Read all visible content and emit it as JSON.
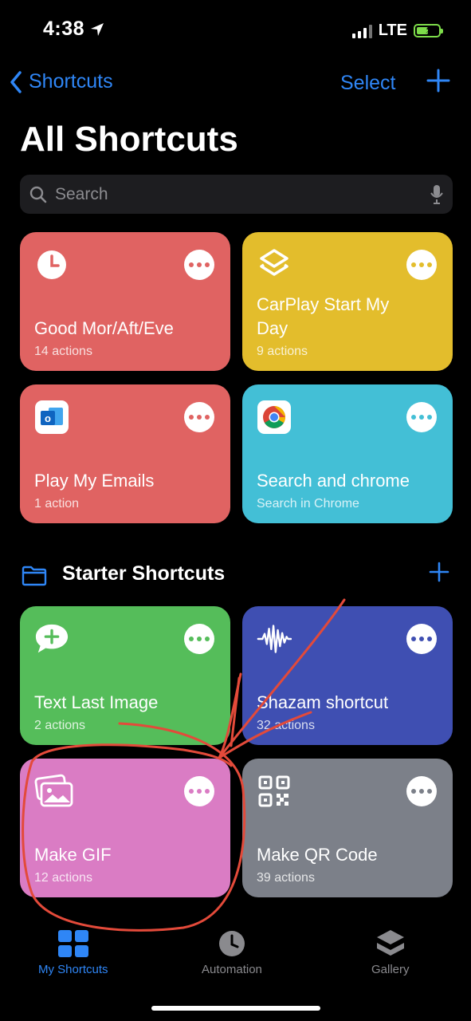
{
  "status": {
    "time": "4:38",
    "network": "LTE"
  },
  "nav": {
    "back_label": "Shortcuts",
    "select_label": "Select",
    "title": "All Shortcuts"
  },
  "search": {
    "placeholder": "Search"
  },
  "shortcuts": [
    {
      "name": "Good Mor/Aft/Eve",
      "sub": "14 actions",
      "color": "#e06362",
      "icon": "clock-icon"
    },
    {
      "name": "CarPlay Start My Day",
      "sub": "9 actions",
      "color": "#e3bd2c",
      "icon": "layers-icon"
    },
    {
      "name": "Play My Emails",
      "sub": "1 action",
      "color": "#e06362",
      "icon": "outlook-icon"
    },
    {
      "name": "Search and chrome",
      "sub": "Search in Chrome",
      "color": "#43bfd6",
      "icon": "chrome-icon"
    }
  ],
  "section": {
    "title": "Starter Shortcuts"
  },
  "starter": [
    {
      "name": "Text Last Image",
      "sub": "2 actions",
      "color": "#55bd5a",
      "icon": "message-plus-icon"
    },
    {
      "name": "Shazam shortcut",
      "sub": "32 actions",
      "color": "#3f4fb2",
      "icon": "waveform-icon"
    },
    {
      "name": "Make GIF",
      "sub": "12 actions",
      "color": "#da7cc4",
      "icon": "photos-icon"
    },
    {
      "name": "Make QR Code",
      "sub": "39 actions",
      "color": "#7c8089",
      "icon": "qr-code-icon"
    }
  ],
  "tabs": [
    {
      "label": "My Shortcuts",
      "active": true
    },
    {
      "label": "Automation",
      "active": false
    },
    {
      "label": "Gallery",
      "active": false
    }
  ],
  "colors": {
    "accent": "#2f86f6",
    "annotation": "#e34a3a"
  }
}
